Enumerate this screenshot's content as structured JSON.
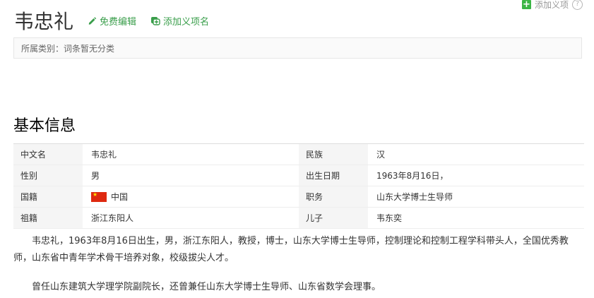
{
  "top_right": {
    "add_item_label": "添加义项"
  },
  "header": {
    "title": "韦忠礼",
    "edit_label": "免费编辑",
    "add_item_label": "添加义项名"
  },
  "category_text": "所属类别：词条暂无分类",
  "section_title": "基本信息",
  "info": [
    {
      "left_name": "中文名",
      "left_value": "韦忠礼",
      "right_name": "民族",
      "right_value": "汉"
    },
    {
      "left_name": "性别",
      "left_value": "男",
      "right_name": "出生日期",
      "right_value": "1963年8月16日，"
    },
    {
      "left_name": "国籍",
      "left_value": "中国",
      "right_name": "职务",
      "right_value": "山东大学博士生导师"
    },
    {
      "left_name": "祖籍",
      "left_value": "浙江东阳人",
      "right_name": "儿子",
      "right_value": "韦东奕"
    }
  ],
  "paragraphs": [
    "韦忠礼，1963年8月16日出生，男，浙江东阳人，教授，博士，山东大学博士生导师，控制理论和控制工程学科带头人，全国优秀教师，山东省中青年学术骨干培养对象，校级拔尖人才。",
    "曾任山东建筑大学理学院副院长，还曾兼任山东大学博士生导师、山东省数学会理事。"
  ],
  "colors": {
    "accent_green": "#3a9e4b",
    "flag_red": "#de2910"
  },
  "icons": {
    "edit": "pencil-icon",
    "add_item": "add-item-icon",
    "plus": "plus-icon",
    "help": "help-icon",
    "flag": "china-flag-icon"
  }
}
